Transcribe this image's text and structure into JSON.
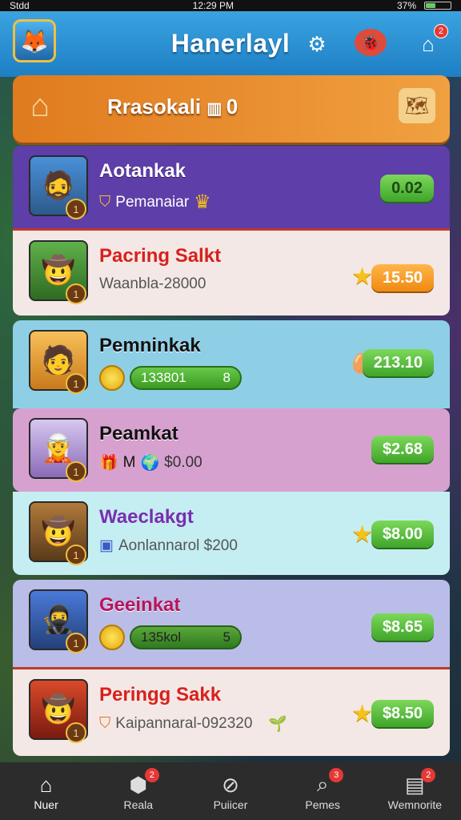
{
  "statusbar": {
    "carrier": "Stdd",
    "time": "12:29 PM",
    "battery": "37%"
  },
  "header": {
    "title": "Hanerlayl"
  },
  "header_icons": {
    "logo": "treasure-logo-icon",
    "settings": "gear-icon",
    "mascot": "mascot-icon",
    "home": "home-icon",
    "home_badge": "2"
  },
  "banner": {
    "title": "Rrasokali",
    "count": "0"
  },
  "rows": [
    {
      "name": "Aotankak",
      "sub": "Pemanaiar",
      "price": "0.02",
      "price_style": "green",
      "name_color": "#ffffff",
      "bg": "#5e3ea8"
    },
    {
      "name": "Pacring Salkt",
      "sub": "Waanbla-28000",
      "price": "15.50",
      "price_style": "orange",
      "name_color": "#d8211c",
      "bg": "#f4e8e6"
    },
    {
      "name": "Pemninkak",
      "sub": "133801",
      "sub2": "8",
      "price": "213.10",
      "price_style": "green",
      "name_color": "#111111",
      "bg": "#8ecfe6"
    },
    {
      "name": "Peamkat",
      "sub": "M",
      "sub2": "$0.00",
      "price": "$2.68",
      "price_style": "green",
      "name_color": "#111111",
      "bg": "#d7a1cf"
    },
    {
      "name": "Waeclakgt",
      "sub": "Aonlannarol $200",
      "price": "$8.00",
      "price_style": "green",
      "name_color": "#7a2eb0",
      "bg": "#c5eef2"
    },
    {
      "name": "Geeinkat",
      "sub": "135kol",
      "sub2": "5",
      "price": "$8.65",
      "price_style": "green",
      "name_color": "#b8145a",
      "bg": "#b9bde8"
    },
    {
      "name": "Peringg Sakk",
      "sub": "Kaipannaral-092320",
      "price": "$8.50",
      "price_style": "green",
      "name_color": "#d8211c",
      "bg": "#f4e8e6"
    }
  ],
  "nav": [
    {
      "label": "Nuer",
      "icon": "home-icon",
      "badge": ""
    },
    {
      "label": "Reala",
      "icon": "shield-icon",
      "badge": "2"
    },
    {
      "label": "Puiicer",
      "icon": "compass-icon",
      "badge": ""
    },
    {
      "label": "Pemes",
      "icon": "search-icon",
      "badge": "3"
    },
    {
      "label": "Wemnorite",
      "icon": "inbox-icon",
      "badge": "2"
    }
  ]
}
